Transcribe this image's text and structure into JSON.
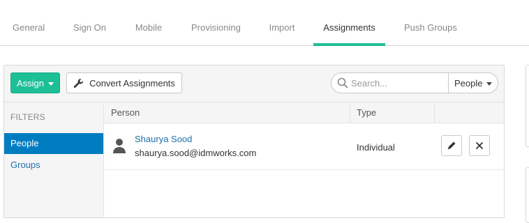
{
  "tabs": [
    {
      "label": "General",
      "active": false
    },
    {
      "label": "Sign On",
      "active": false
    },
    {
      "label": "Mobile",
      "active": false
    },
    {
      "label": "Provisioning",
      "active": false
    },
    {
      "label": "Import",
      "active": false
    },
    {
      "label": "Assignments",
      "active": true
    },
    {
      "label": "Push Groups",
      "active": false
    }
  ],
  "toolbar": {
    "assign_label": "Assign",
    "convert_label": "Convert Assignments",
    "search_placeholder": "Search...",
    "search_value": "",
    "search_scope": "People"
  },
  "filters": {
    "title": "FILTERS",
    "items": [
      {
        "label": "People",
        "active": true
      },
      {
        "label": "Groups",
        "active": false
      }
    ]
  },
  "table": {
    "columns": [
      "Person",
      "Type",
      ""
    ],
    "rows": [
      {
        "name": "Shaurya Sood",
        "email": "shaurya.sood@idmworks.com",
        "type": "Individual"
      }
    ]
  },
  "colors": {
    "accent": "#1dbf97",
    "active_filter": "#007dc1",
    "link": "#1f6fa8"
  },
  "icons": [
    "wrench-icon",
    "search-icon",
    "person-icon",
    "edit-icon",
    "close-icon"
  ]
}
